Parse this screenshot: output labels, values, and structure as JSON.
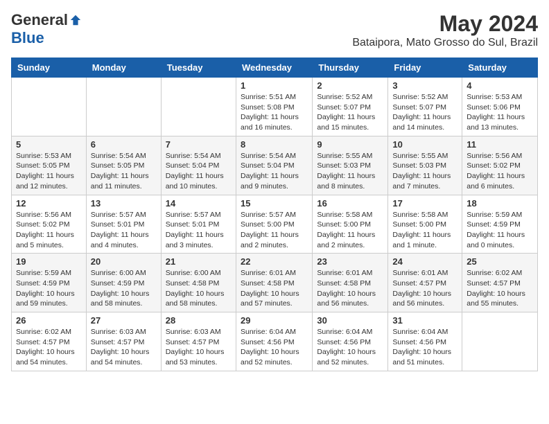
{
  "logo": {
    "general": "General",
    "blue": "Blue"
  },
  "title": {
    "month": "May 2024",
    "location": "Bataipora, Mato Grosso do Sul, Brazil"
  },
  "days_of_week": [
    "Sunday",
    "Monday",
    "Tuesday",
    "Wednesday",
    "Thursday",
    "Friday",
    "Saturday"
  ],
  "weeks": [
    [
      {
        "day": "",
        "info": ""
      },
      {
        "day": "",
        "info": ""
      },
      {
        "day": "",
        "info": ""
      },
      {
        "day": "1",
        "info": "Sunrise: 5:51 AM\nSunset: 5:08 PM\nDaylight: 11 hours and 16 minutes."
      },
      {
        "day": "2",
        "info": "Sunrise: 5:52 AM\nSunset: 5:07 PM\nDaylight: 11 hours and 15 minutes."
      },
      {
        "day": "3",
        "info": "Sunrise: 5:52 AM\nSunset: 5:07 PM\nDaylight: 11 hours and 14 minutes."
      },
      {
        "day": "4",
        "info": "Sunrise: 5:53 AM\nSunset: 5:06 PM\nDaylight: 11 hours and 13 minutes."
      }
    ],
    [
      {
        "day": "5",
        "info": "Sunrise: 5:53 AM\nSunset: 5:05 PM\nDaylight: 11 hours and 12 minutes."
      },
      {
        "day": "6",
        "info": "Sunrise: 5:54 AM\nSunset: 5:05 PM\nDaylight: 11 hours and 11 minutes."
      },
      {
        "day": "7",
        "info": "Sunrise: 5:54 AM\nSunset: 5:04 PM\nDaylight: 11 hours and 10 minutes."
      },
      {
        "day": "8",
        "info": "Sunrise: 5:54 AM\nSunset: 5:04 PM\nDaylight: 11 hours and 9 minutes."
      },
      {
        "day": "9",
        "info": "Sunrise: 5:55 AM\nSunset: 5:03 PM\nDaylight: 11 hours and 8 minutes."
      },
      {
        "day": "10",
        "info": "Sunrise: 5:55 AM\nSunset: 5:03 PM\nDaylight: 11 hours and 7 minutes."
      },
      {
        "day": "11",
        "info": "Sunrise: 5:56 AM\nSunset: 5:02 PM\nDaylight: 11 hours and 6 minutes."
      }
    ],
    [
      {
        "day": "12",
        "info": "Sunrise: 5:56 AM\nSunset: 5:02 PM\nDaylight: 11 hours and 5 minutes."
      },
      {
        "day": "13",
        "info": "Sunrise: 5:57 AM\nSunset: 5:01 PM\nDaylight: 11 hours and 4 minutes."
      },
      {
        "day": "14",
        "info": "Sunrise: 5:57 AM\nSunset: 5:01 PM\nDaylight: 11 hours and 3 minutes."
      },
      {
        "day": "15",
        "info": "Sunrise: 5:57 AM\nSunset: 5:00 PM\nDaylight: 11 hours and 2 minutes."
      },
      {
        "day": "16",
        "info": "Sunrise: 5:58 AM\nSunset: 5:00 PM\nDaylight: 11 hours and 2 minutes."
      },
      {
        "day": "17",
        "info": "Sunrise: 5:58 AM\nSunset: 5:00 PM\nDaylight: 11 hours and 1 minute."
      },
      {
        "day": "18",
        "info": "Sunrise: 5:59 AM\nSunset: 4:59 PM\nDaylight: 11 hours and 0 minutes."
      }
    ],
    [
      {
        "day": "19",
        "info": "Sunrise: 5:59 AM\nSunset: 4:59 PM\nDaylight: 10 hours and 59 minutes."
      },
      {
        "day": "20",
        "info": "Sunrise: 6:00 AM\nSunset: 4:59 PM\nDaylight: 10 hours and 58 minutes."
      },
      {
        "day": "21",
        "info": "Sunrise: 6:00 AM\nSunset: 4:58 PM\nDaylight: 10 hours and 58 minutes."
      },
      {
        "day": "22",
        "info": "Sunrise: 6:01 AM\nSunset: 4:58 PM\nDaylight: 10 hours and 57 minutes."
      },
      {
        "day": "23",
        "info": "Sunrise: 6:01 AM\nSunset: 4:58 PM\nDaylight: 10 hours and 56 minutes."
      },
      {
        "day": "24",
        "info": "Sunrise: 6:01 AM\nSunset: 4:57 PM\nDaylight: 10 hours and 56 minutes."
      },
      {
        "day": "25",
        "info": "Sunrise: 6:02 AM\nSunset: 4:57 PM\nDaylight: 10 hours and 55 minutes."
      }
    ],
    [
      {
        "day": "26",
        "info": "Sunrise: 6:02 AM\nSunset: 4:57 PM\nDaylight: 10 hours and 54 minutes."
      },
      {
        "day": "27",
        "info": "Sunrise: 6:03 AM\nSunset: 4:57 PM\nDaylight: 10 hours and 54 minutes."
      },
      {
        "day": "28",
        "info": "Sunrise: 6:03 AM\nSunset: 4:57 PM\nDaylight: 10 hours and 53 minutes."
      },
      {
        "day": "29",
        "info": "Sunrise: 6:04 AM\nSunset: 4:56 PM\nDaylight: 10 hours and 52 minutes."
      },
      {
        "day": "30",
        "info": "Sunrise: 6:04 AM\nSunset: 4:56 PM\nDaylight: 10 hours and 52 minutes."
      },
      {
        "day": "31",
        "info": "Sunrise: 6:04 AM\nSunset: 4:56 PM\nDaylight: 10 hours and 51 minutes."
      },
      {
        "day": "",
        "info": ""
      }
    ]
  ]
}
